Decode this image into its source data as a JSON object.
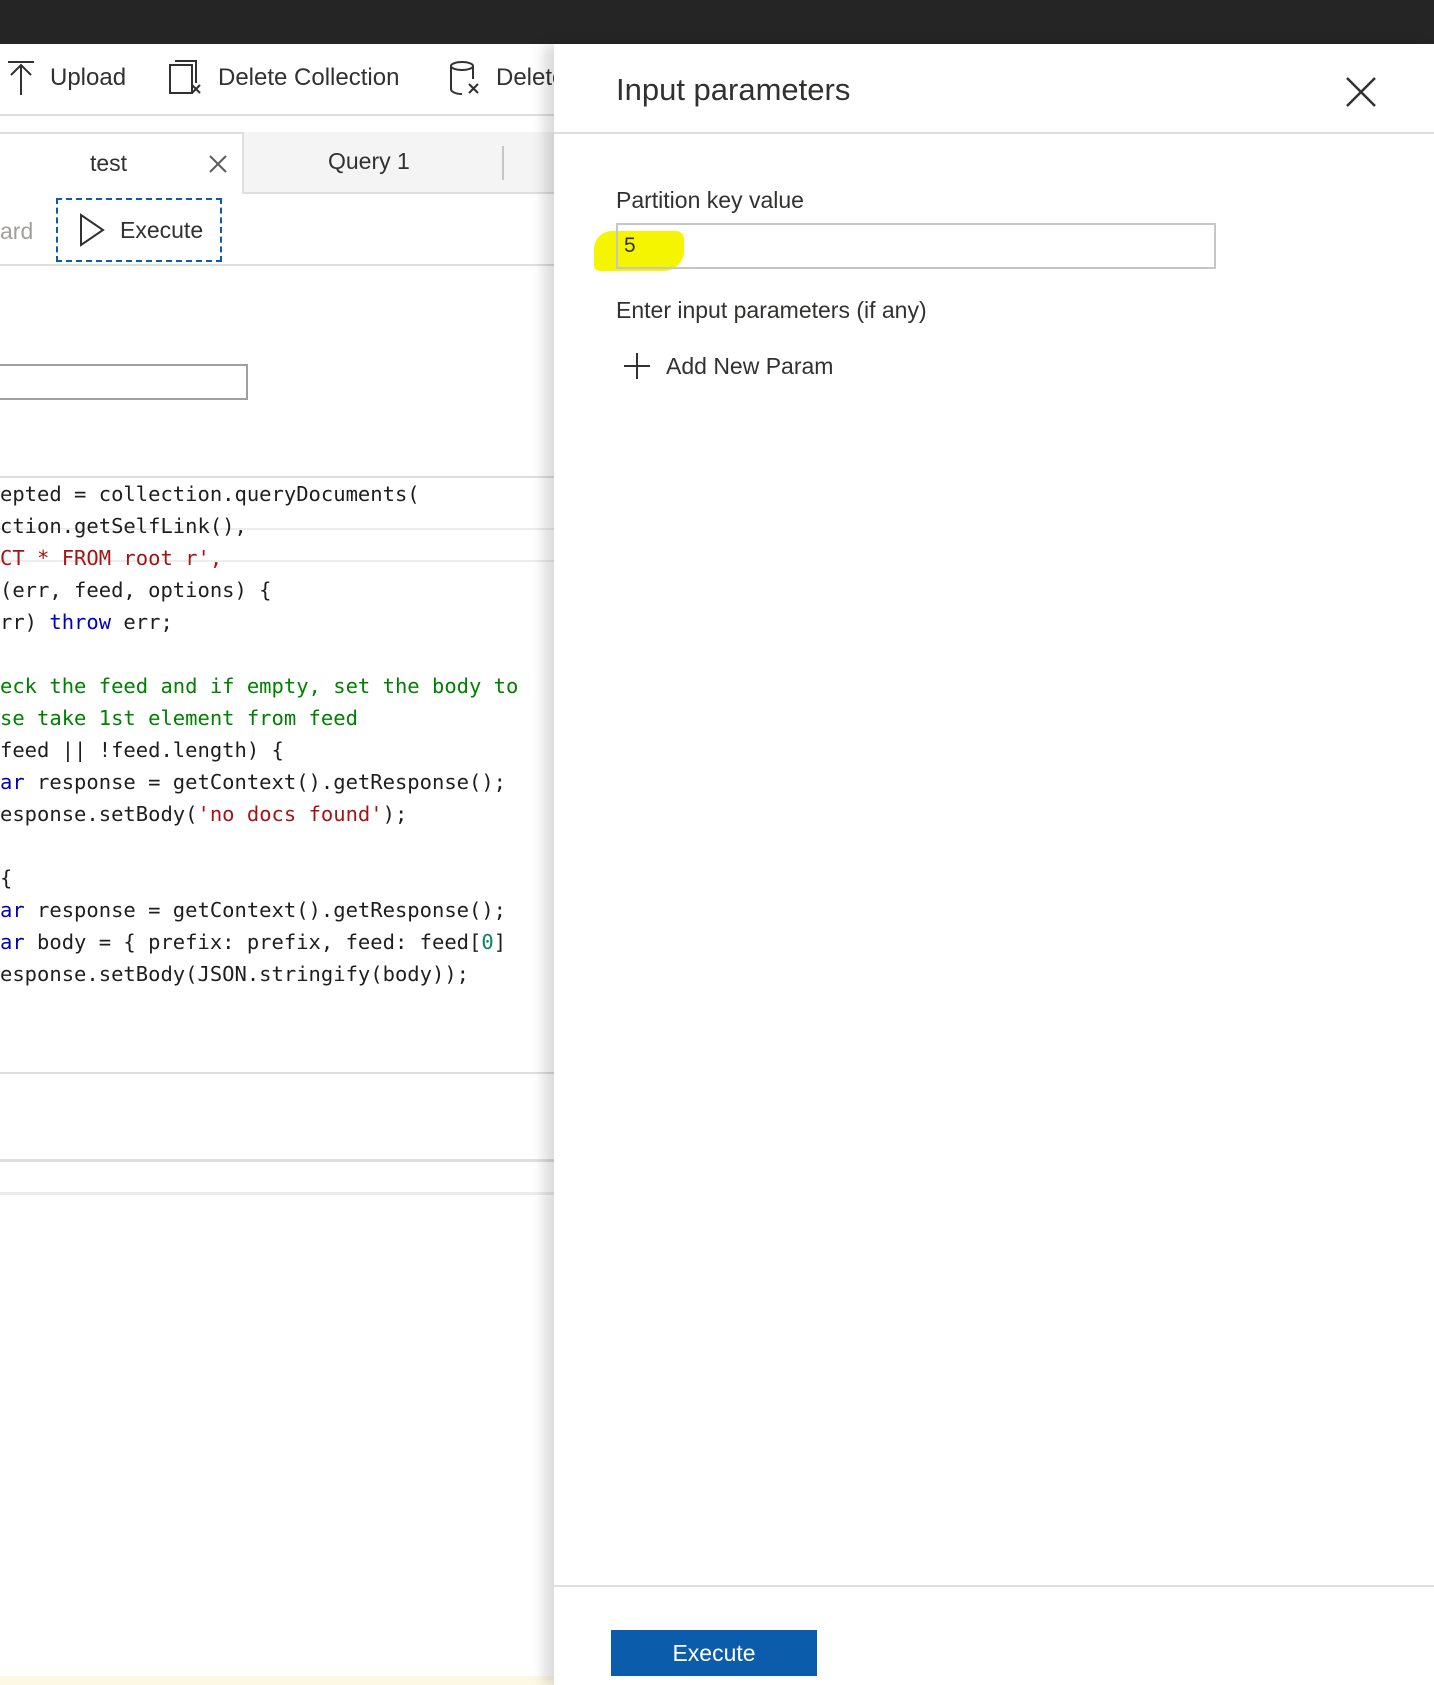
{
  "toolbar": {
    "upload_label": "Upload",
    "delete_collection_label": "Delete Collection",
    "delete_label": "Delete"
  },
  "tabs": [
    {
      "label": "test"
    },
    {
      "label": "Query 1"
    }
  ],
  "subtoolbar": {
    "truncated_label": "ard",
    "execute_label": "Execute"
  },
  "code_lines": [
    [
      {
        "t": "epted = collection.queryDocuments(",
        "c": ""
      }
    ],
    [
      {
        "t": "ction.getSelfLink(),",
        "c": ""
      }
    ],
    [
      {
        "t": "CT * FROM root r',",
        "c": "str"
      }
    ],
    [
      {
        "t": "(err, feed, options) {",
        "c": ""
      }
    ],
    [
      {
        "t": "rr) ",
        "c": ""
      },
      {
        "t": "throw",
        "c": "kw"
      },
      {
        "t": " err;",
        "c": ""
      }
    ],
    [
      {
        "t": "",
        "c": ""
      }
    ],
    [
      {
        "t": "eck the feed and if empty, set the body to",
        "c": "cm"
      }
    ],
    [
      {
        "t": "se take 1st element from feed",
        "c": "cm"
      }
    ],
    [
      {
        "t": "feed || !feed.length) {",
        "c": ""
      }
    ],
    [
      {
        "t": "ar",
        "c": "kw"
      },
      {
        "t": " response = getContext().getResponse();",
        "c": ""
      }
    ],
    [
      {
        "t": "esponse.setBody(",
        "c": ""
      },
      {
        "t": "'no docs found'",
        "c": "str"
      },
      {
        "t": ");",
        "c": ""
      }
    ],
    [
      {
        "t": "",
        "c": ""
      }
    ],
    [
      {
        "t": "{",
        "c": ""
      }
    ],
    [
      {
        "t": "ar",
        "c": "kw"
      },
      {
        "t": " response = getContext().getResponse();",
        "c": ""
      }
    ],
    [
      {
        "t": "ar",
        "c": "kw"
      },
      {
        "t": " body = { prefix: prefix, feed: feed[",
        "c": ""
      },
      {
        "t": "0",
        "c": "num"
      },
      {
        "t": "]",
        "c": ""
      }
    ],
    [
      {
        "t": "esponse.setBody(JSON.stringify(body));",
        "c": ""
      }
    ]
  ],
  "panel": {
    "title": "Input parameters",
    "partition_label": "Partition key value",
    "partition_value": "5",
    "params_label": "Enter input parameters (if any)",
    "add_param_label": "Add New Param",
    "execute_label": "Execute"
  },
  "colors": {
    "accent": "#0b5cab",
    "highlight": "#f5f500",
    "topbar": "#252526"
  }
}
